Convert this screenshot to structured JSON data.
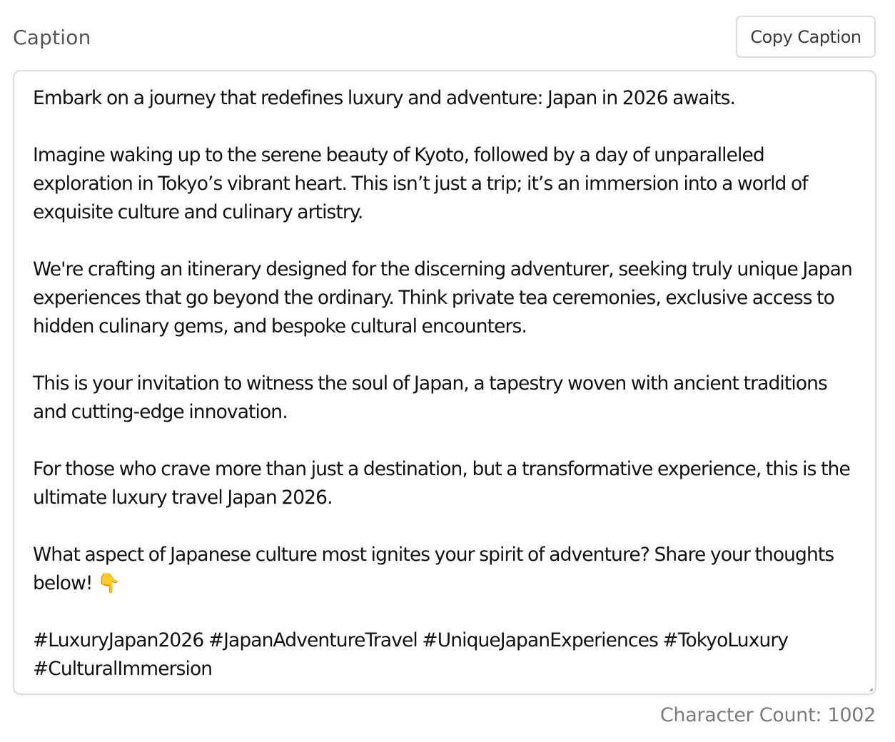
{
  "caption_label": "Caption",
  "copy_button_label": "Copy Caption",
  "caption": {
    "paragraphs": [
      "Embark on a journey that redefines luxury and adventure: Japan in 2026 awaits.",
      "Imagine waking up to the serene beauty of Kyoto, followed by a day of unparalleled exploration in Tokyo’s vibrant heart. This isn’t just a trip; it’s an immersion into a world of exquisite culture and culinary artistry.",
      "We're crafting an itinerary designed for the discerning adventurer, seeking truly unique Japan experiences that go beyond the ordinary. Think private tea ceremonies, exclusive access to hidden culinary gems, and bespoke cultural encounters.",
      "This is your invitation to witness the soul of Japan, a tapestry woven with ancient traditions and cutting-edge innovation.",
      "For those who crave more than just a destination, but a transformative experience, this is the ultimate luxury travel Japan 2026.",
      "What aspect of Japanese culture most ignites your spirit of adventure? Share your thoughts below! 👇",
      "#LuxuryJapan2026 #JapanAdventureTravel #UniqueJapanExperiences #TokyoLuxury #CulturalImmersion"
    ]
  },
  "character_count": "Character Count: 1002"
}
